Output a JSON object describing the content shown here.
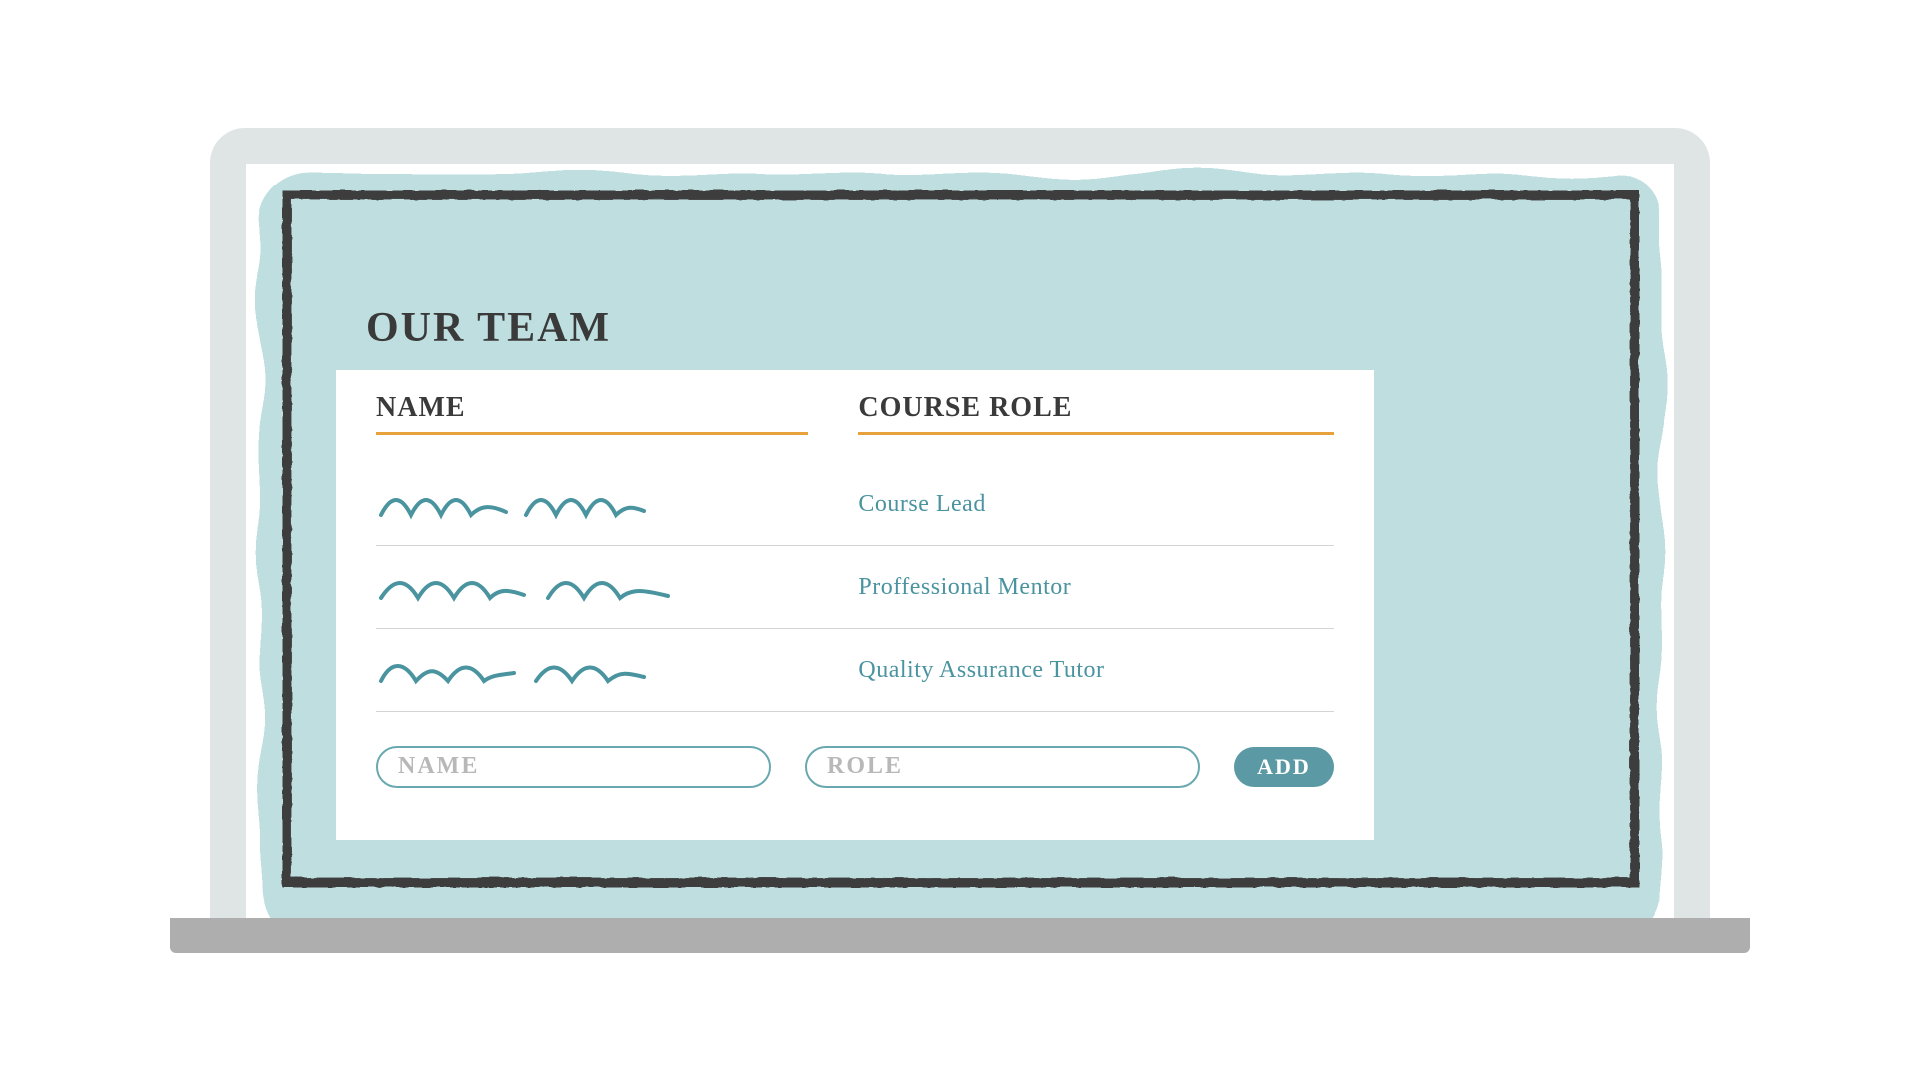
{
  "page": {
    "title": "OUR TEAM"
  },
  "table": {
    "headers": {
      "name": "NAME",
      "role": "COURSE ROLE"
    },
    "rows": [
      {
        "name_placeholder": "signature-1",
        "role": "Course Lead"
      },
      {
        "name_placeholder": "signature-2",
        "role": "Proffessional Mentor"
      },
      {
        "name_placeholder": "signature-3",
        "role": "Quality Assurance Tutor"
      }
    ]
  },
  "form": {
    "name_placeholder": "NAME",
    "role_placeholder": "ROLE",
    "add_label": "ADD"
  },
  "colors": {
    "teal_bg": "#bedee0",
    "teal_accent": "#5b9aa4",
    "teal_text": "#4a94a0",
    "orange_rule": "#e9a23b",
    "charcoal": "#3a3a3a"
  }
}
